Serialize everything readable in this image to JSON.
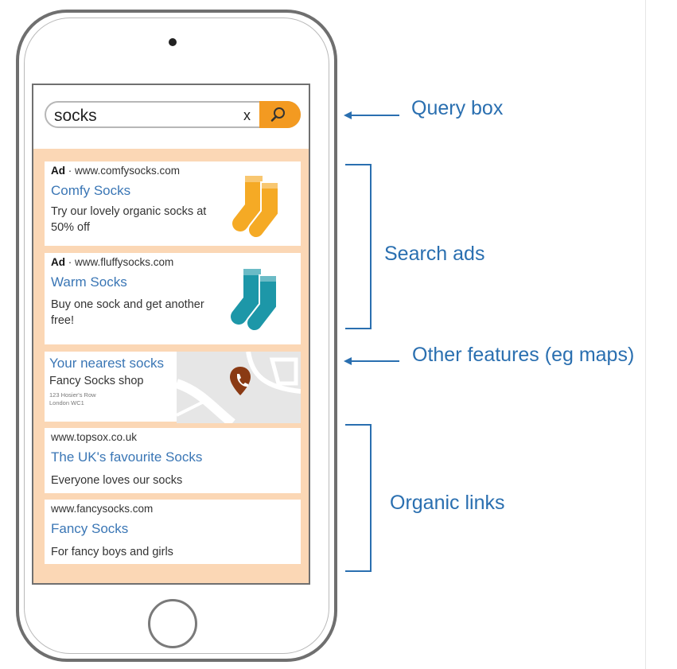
{
  "search": {
    "query": "socks",
    "clear_label": "x"
  },
  "results": {
    "ad1": {
      "badge": "Ad",
      "url": " · www.comfysocks.com",
      "title": "Comfy Socks",
      "description": "Try our lovely organic socks at 50% off",
      "sock_color": "#f5aa25"
    },
    "ad2": {
      "badge": "Ad",
      "url": " · www.fluffysocks.com",
      "title": "Warm Socks",
      "description": "Buy one sock and get another free!",
      "sock_color": "#1d97a8"
    },
    "local": {
      "title": "Your nearest socks",
      "shop_name": "Fancy Socks shop",
      "address_line1": "123 Hosier's Row",
      "address_line2": "London WC1",
      "pin_color": "#8a3a14"
    },
    "organic1": {
      "url": "www.topsox.co.uk",
      "title": "The UK's favourite Socks",
      "description": "Everyone loves our socks"
    },
    "organic2": {
      "url": "www.fancysocks.com",
      "title": "Fancy Socks",
      "description": "For fancy boys and girls"
    }
  },
  "annotations": {
    "query_box": "Query box",
    "search_ads": "Search ads",
    "other_features": "Other features (eg maps)",
    "organic_links": "Organic links"
  },
  "colors": {
    "screen_background": "#fbd7b5",
    "search_button": "#f39a21",
    "link_blue": "#3a76b5",
    "annotation_blue": "#2a6fb0"
  }
}
